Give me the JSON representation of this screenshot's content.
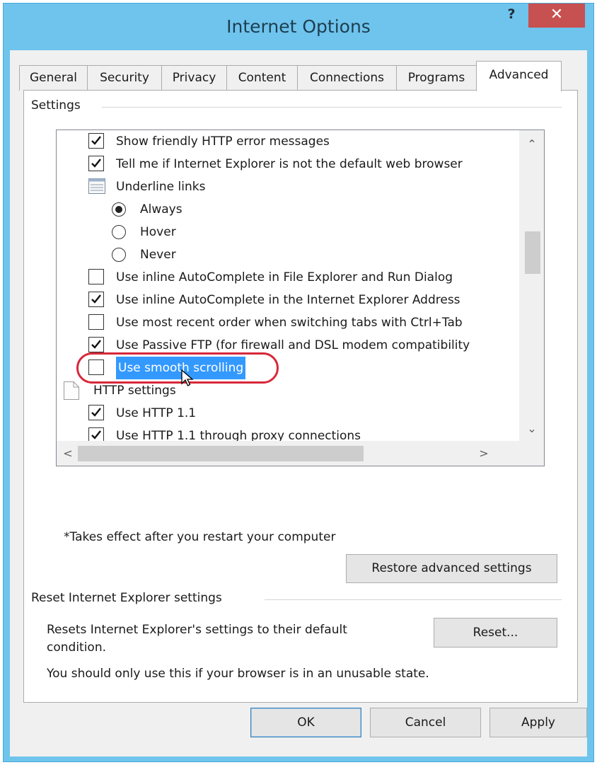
{
  "window": {
    "title": "Internet Options",
    "help_glyph": "?",
    "close_glyph": "✕"
  },
  "tabs": [
    {
      "label": "General"
    },
    {
      "label": "Security"
    },
    {
      "label": "Privacy"
    },
    {
      "label": "Content"
    },
    {
      "label": "Connections"
    },
    {
      "label": "Programs"
    },
    {
      "label": "Advanced"
    }
  ],
  "active_tab": "Advanced",
  "settings": {
    "group_label": "Settings",
    "items": [
      {
        "kind": "checkbox",
        "checked": true,
        "label": "Show friendly HTTP error messages"
      },
      {
        "kind": "checkbox",
        "checked": true,
        "label": "Tell me if Internet Explorer is not the default web browser"
      },
      {
        "kind": "category",
        "icon": "list-category-icon",
        "label": "Underline links"
      },
      {
        "kind": "radio",
        "selected": true,
        "label": "Always"
      },
      {
        "kind": "radio",
        "selected": false,
        "label": "Hover"
      },
      {
        "kind": "radio",
        "selected": false,
        "label": "Never"
      },
      {
        "kind": "checkbox",
        "checked": false,
        "label": "Use inline AutoComplete in File Explorer and Run Dialog"
      },
      {
        "kind": "checkbox",
        "checked": true,
        "label": "Use inline AutoComplete in the Internet Explorer Address"
      },
      {
        "kind": "checkbox",
        "checked": false,
        "label": "Use most recent order when switching tabs with Ctrl+Tab"
      },
      {
        "kind": "checkbox",
        "checked": true,
        "label": "Use Passive FTP (for firewall and DSL modem compatibility"
      },
      {
        "kind": "checkbox",
        "checked": false,
        "label": "Use smooth scrolling",
        "highlighted": true
      },
      {
        "kind": "category",
        "icon": "document-category-icon",
        "label": "HTTP settings"
      },
      {
        "kind": "checkbox",
        "checked": true,
        "label": "Use HTTP 1.1"
      },
      {
        "kind": "checkbox",
        "checked": true,
        "label": "Use HTTP 1.1 through proxy connections"
      }
    ],
    "restart_note": "*Takes effect after you restart your computer",
    "restore_button": "Restore advanced settings"
  },
  "reset_section": {
    "group_label": "Reset Internet Explorer settings",
    "description_line1": "Resets Internet Explorer's settings to their default",
    "description_line2": "condition.",
    "warning": "You should only use this if your browser is in an unusable state.",
    "reset_button": "Reset..."
  },
  "footer": {
    "ok": "OK",
    "cancel": "Cancel",
    "apply": "Apply"
  },
  "colors": {
    "title_bar": "#6ec4ec",
    "close_button": "#c75050",
    "selection_highlight": "#3399ff",
    "annotation_ring": "#d8283a"
  }
}
